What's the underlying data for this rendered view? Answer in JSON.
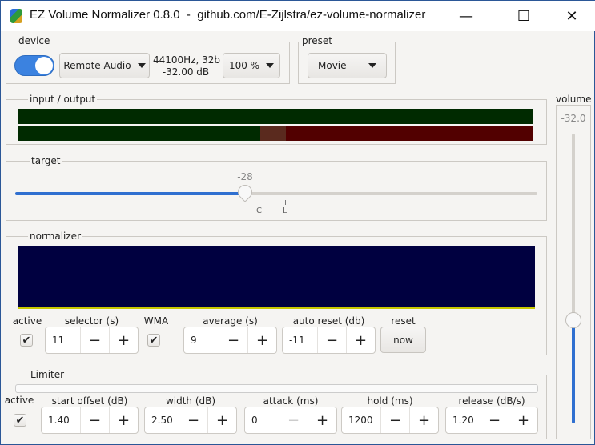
{
  "window": {
    "title": "EZ Volume Normalizer 0.8.0  -  github.com/E-Zijlstra/ez-volume-normalizer",
    "minimize": "—",
    "maximize": "☐",
    "close": "✕"
  },
  "device": {
    "label": "device",
    "enabled": true,
    "device_name": "Remote Audio",
    "format": "44100Hz, 32b",
    "level": "-32.00 dB",
    "scale": "100 %"
  },
  "preset": {
    "label": "preset",
    "value": "Movie"
  },
  "io": {
    "label": "input / output",
    "input_level": 1.0,
    "output_green": 0.47,
    "output_orange": 0.05
  },
  "target": {
    "label": "target",
    "value": "-28",
    "marks": [
      "C",
      "L"
    ],
    "fraction": 0.44
  },
  "normalizer": {
    "label": "normalizer",
    "active_label": "active",
    "active": true,
    "selector_label": "selector (s)",
    "selector": "11",
    "wma_label": "WMA",
    "wma": true,
    "average_label": "average (s)",
    "average": "9",
    "auto_reset_label": "auto reset (db)",
    "auto_reset": "-11",
    "reset_label": "reset",
    "reset_button": "now"
  },
  "limiter": {
    "label": "Limiter",
    "active_label": "active",
    "active": true,
    "start_offset_label": "start offset (dB)",
    "start_offset": "1.40",
    "width_label": "width (dB)",
    "width": "2.50",
    "attack_label": "attack (ms)",
    "attack": "0",
    "hold_label": "hold (ms)",
    "hold": "1200",
    "release_label": "release (dB/s)",
    "release": "1.20"
  },
  "volume": {
    "label": "volume",
    "value": "-32.0",
    "fraction": 0.36
  },
  "spin": {
    "minus": "−",
    "plus": "+"
  },
  "check": "✔"
}
